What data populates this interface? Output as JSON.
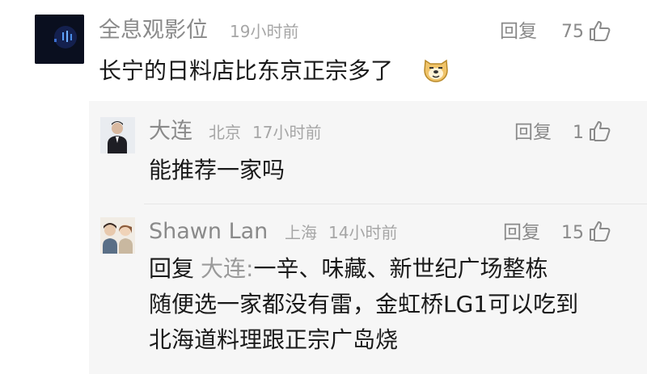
{
  "comment": {
    "author": "全息观影位",
    "time": "19小时前",
    "reply_label": "回复",
    "likes": "75",
    "text": "长宁的日料店比东京正宗多了"
  },
  "replies": [
    {
      "author": "大连",
      "location": "北京",
      "time": "17小时前",
      "reply_label": "回复",
      "likes": "1",
      "text": "能推荐一家吗"
    },
    {
      "author": "Shawn Lan",
      "location": "上海",
      "time": "14小时前",
      "reply_label": "回复",
      "likes": "15",
      "reply_prefix": "回复",
      "mention": "大连:",
      "text_line1": "一辛、味藏、新世纪广场整栋",
      "text_line2": "随便选一家都没有雷，金虹桥LG1可以吃到",
      "text_line3": "北海道料理跟正宗广岛烧"
    }
  ],
  "icons": {
    "like": "thumbs-up-icon",
    "emoji": "doge-emoji-icon"
  }
}
